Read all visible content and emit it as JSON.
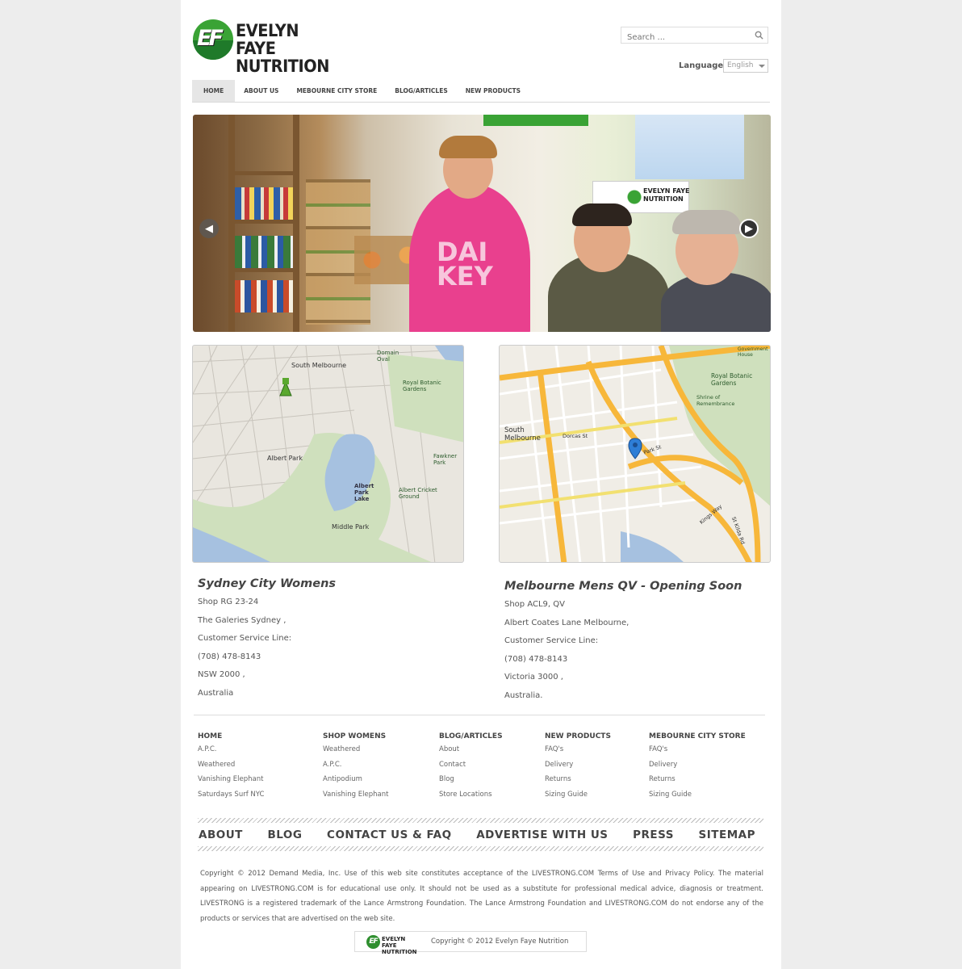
{
  "brand": {
    "badge": "EF",
    "line1": "EVELYN FAYE",
    "line2": "NUTRITION",
    "green": "#3aa335",
    "dark_green": "#1f7a2a"
  },
  "search": {
    "placeholder": "Search ..."
  },
  "language": {
    "label": "Language",
    "selected": "English"
  },
  "nav": {
    "items": [
      "HOME",
      "ABOUT US",
      "MEBOURNE CITY STORE",
      "BLOG/ARTICLES",
      "NEW PRODUCTS"
    ],
    "active": "HOME"
  },
  "slider": {
    "prev_icon": "chevron-left-icon",
    "next_icon": "chevron-right-icon"
  },
  "stores": [
    {
      "title": "Sydney City Womens",
      "lines": [
        "Shop RG 23-24",
        "The Galeries Sydney ,",
        "Customer Service Line:",
        "(708) 478-8143",
        "NSW 2000 ,",
        "Australia"
      ]
    },
    {
      "title": "Melbourne Mens QV - Opening Soon",
      "lines": [
        "Shop ACL9, QV",
        "Albert Coates Lane Melbourne,",
        "Customer Service Line:",
        "(708) 478-8143",
        "Victoria 3000 ,",
        "Australia."
      ]
    }
  ],
  "maps": [
    {
      "labels": [
        "South Melbourne",
        "Albert Park",
        "Albert Park Lake",
        "Middle Park",
        "Royal Botanic Gardens",
        "Domain Oval",
        "Fawkner Park",
        "Albert Cricket Ground"
      ]
    },
    {
      "labels": [
        "South Melbourne",
        "Royal Botanic Gardens",
        "Shrine of Remembrance",
        "Government House",
        "Kings Way",
        "Park St",
        "Dorcas St",
        "St Kilda Rd"
      ]
    }
  ],
  "footer_cols": [
    {
      "heading": "HOME",
      "links": [
        "A.P.C.",
        "Weathered",
        "Vanishing Elephant",
        "Saturdays Surf NYC"
      ]
    },
    {
      "heading": "SHOP WOMENS",
      "links": [
        "Weathered",
        "A.P.C.",
        "Antipodium",
        "Vanishing Elephant"
      ]
    },
    {
      "heading": "BLOG/ARTICLES",
      "links": [
        "About",
        "Contact",
        "Blog",
        "Store Locations"
      ]
    },
    {
      "heading": "NEW PRODUCTS",
      "links": [
        "FAQ's",
        "Delivery",
        "Returns",
        "Sizing Guide"
      ]
    },
    {
      "heading": "MEBOURNE CITY STORE",
      "links": [
        "FAQ's",
        "Delivery",
        "Returns",
        "Sizing Guide"
      ]
    }
  ],
  "bignav": [
    "ABOUT",
    "BLOG",
    "CONTACT US & FAQ",
    "ADVERTISE WITH US",
    "PRESS",
    "SITEMAP"
  ],
  "copyright_text": "Copyright © 2012 Demand Media, Inc. Use of this web site constitutes acceptance of the LIVESTRONG.COM Terms of Use and Privacy Policy. The material appearing on LIVESTRONG.COM is for educational use only. It should not be used as a substitute for professional medical advice, diagnosis or treatment. LIVESTRONG is a registered trademark of the Lance Armstrong Foundation. The Lance Armstrong Foundation and LIVESTRONG.COM do not endorse any of the products or services that are advertised on the web site.",
  "credit": {
    "badge": "EF",
    "line1": "EVELYN FAYE",
    "line2": "NUTRITION",
    "text": "Copyright © 2012 Evelyn Faye Nutrition"
  }
}
